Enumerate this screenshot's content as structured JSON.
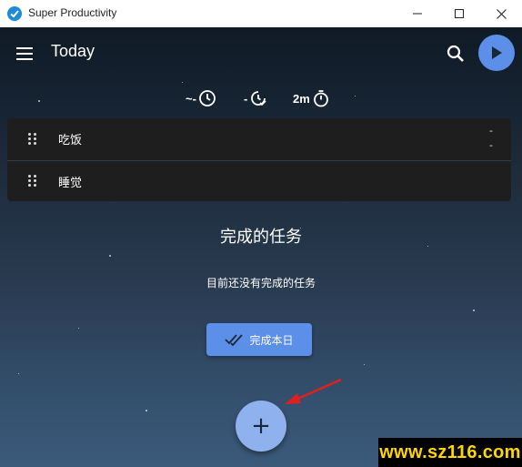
{
  "window": {
    "title": "Super Productivity",
    "minimize_glyph": "—",
    "maximize_glyph": "☐",
    "close_glyph": "✕"
  },
  "header": {
    "title": "Today",
    "icons": [
      "menu-icon",
      "search-icon",
      "play-icon"
    ]
  },
  "time_estimates": [
    {
      "label": "~-",
      "icon": "clock-icon"
    },
    {
      "label": "-",
      "icon": "clock-check-icon"
    },
    {
      "label": "2m",
      "icon": "stopwatch-icon"
    }
  ],
  "tasks": [
    {
      "title": "吃饭",
      "time": "-\n-"
    },
    {
      "title": "睡觉",
      "time": ""
    }
  ],
  "done_section": {
    "title": "完成的任务",
    "empty_text": "目前还没有完成的任务",
    "finish_day_label": "完成本日"
  },
  "fab": {
    "label": "+"
  },
  "watermark": {
    "text": "www.sz116.com"
  },
  "colors": {
    "accent": "#5b8fe8",
    "fab": "#8fb1ee",
    "task_bg": "#1e1e1e",
    "arrow": "#e02020",
    "watermark_text": "#ffd600"
  }
}
